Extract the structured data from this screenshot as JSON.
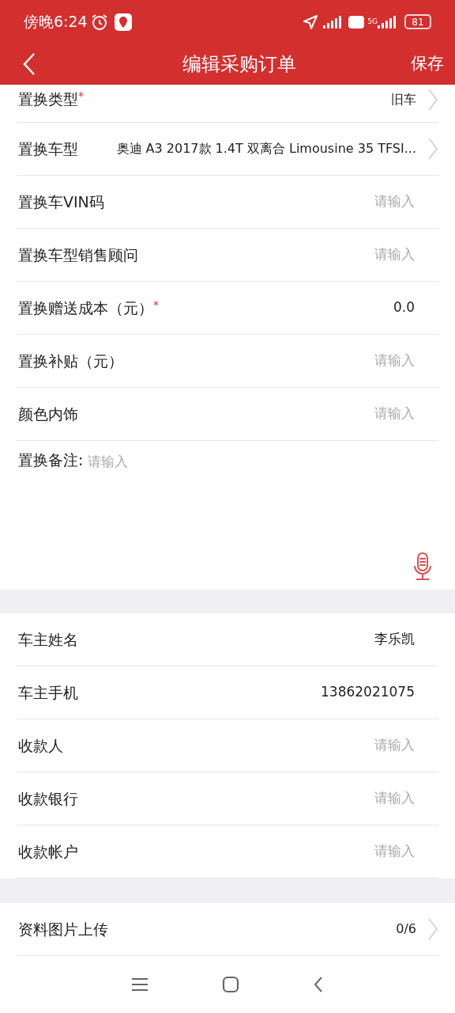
{
  "status_bar": {
    "time": "傍晚6:24",
    "battery": "81",
    "network": "5G"
  },
  "nav": {
    "title": "编辑采购订单",
    "action": "保存"
  },
  "required_mark": "*",
  "section_1": [
    {
      "kind": "select",
      "label": "置换类型",
      "required": true,
      "value": "旧车"
    },
    {
      "kind": "select",
      "label": "置换车型",
      "required": false,
      "value": "奥迪 A3 2017款 1.4T 双离合 Limousine 35 TFSI..."
    },
    {
      "kind": "input",
      "label": "置换车VIN码",
      "required": false,
      "placeholder": "请输入"
    },
    {
      "kind": "input",
      "label": "置换车型销售顾问",
      "required": false,
      "placeholder": "请输入"
    },
    {
      "kind": "input",
      "label": "置换赠送成本（元）",
      "required": true,
      "value": "0.0"
    },
    {
      "kind": "input",
      "label": "置换补贴（元）",
      "required": false,
      "placeholder": "请输入"
    },
    {
      "kind": "input",
      "label": "颜色内饰",
      "required": false,
      "placeholder": "请输入"
    }
  ],
  "notes": {
    "label": "置换备注:",
    "placeholder": "请输入"
  },
  "section_2": [
    {
      "kind": "input",
      "label": "车主姓名",
      "required": false,
      "value": "李乐凯"
    },
    {
      "kind": "input",
      "label": "车主手机",
      "required": false,
      "value": "13862021075"
    },
    {
      "kind": "input",
      "label": "收款人",
      "required": false,
      "placeholder": "请输入"
    },
    {
      "kind": "input",
      "label": "收款银行",
      "required": false,
      "placeholder": "请输入"
    },
    {
      "kind": "input",
      "label": "收款帐户",
      "required": false,
      "placeholder": "请输入"
    }
  ],
  "section_3": [
    {
      "kind": "select",
      "label": "资料图片上传",
      "required": false,
      "value": "0/6"
    }
  ]
}
